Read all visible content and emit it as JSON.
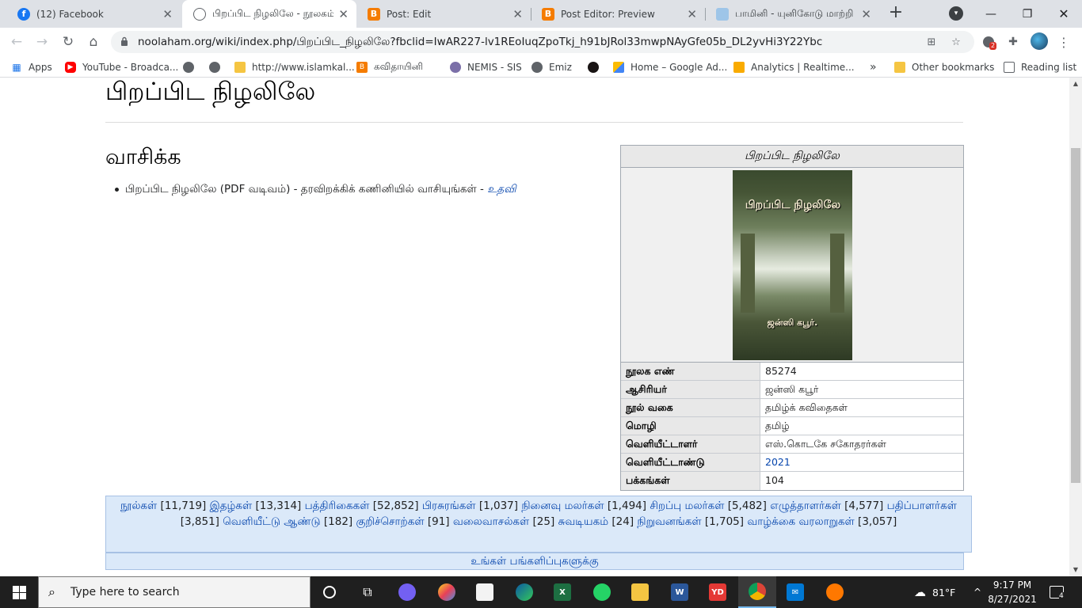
{
  "tabs": [
    {
      "title": "(12) Facebook",
      "close": "✕"
    },
    {
      "title": "பிறப்பிட நிழலிலே - நூலகம்",
      "close": "✕"
    },
    {
      "title": "Post: Edit",
      "close": "✕"
    },
    {
      "title": "Post Editor: Preview",
      "close": "✕"
    },
    {
      "title": "பாமினி - யுனிகோடு மாற்றி",
      "close": "✕"
    }
  ],
  "browser": {
    "url": "noolaham.org/wiki/index.php/பிறப்பிட_நிழலிலே?fbclid=IwAR227-lv1REoIuqZpoTkj_h91bJRol33mwpNAyGfe05b_DL2yvHi3Y22Ybc",
    "extension_badge": "2"
  },
  "bookmarks": [
    {
      "label": "Apps"
    },
    {
      "label": "YouTube - Broadca..."
    },
    {
      "label": "http://www.islamkal..."
    },
    {
      "label": "கவிதாயினி"
    },
    {
      "label": "NEMIS - SIS"
    },
    {
      "label": "Emiz"
    },
    {
      "label": "Home – Google Ad..."
    },
    {
      "label": "Analytics | Realtime..."
    },
    {
      "label": "»"
    },
    {
      "label": "Other bookmarks"
    },
    {
      "label": "Reading list"
    }
  ],
  "page": {
    "title": "பிறப்பிட நிழலிலே",
    "section_heading": "வாசிக்க",
    "read_item": "பிறப்பிட நிழலிலே (PDF வடிவம்) - தரவிறக்கிக் கணினியில் வாசியுங்கள் -",
    "help_link": "உதவி"
  },
  "infobox": {
    "title": "பிறப்பிட நிழலிலே",
    "cover_title": "பிறப்பிட நிழலிலே",
    "cover_author": "ஜன்ஸி கபூர்.",
    "rows": [
      {
        "key": "நூலக எண்",
        "value": "85274"
      },
      {
        "key": "ஆசிரியர்",
        "value": "ஜன்ஸி கபூர்"
      },
      {
        "key": "நூல் வகை",
        "value": "தமிழ்க் கவிதைகள்"
      },
      {
        "key": "மொழி",
        "value": "தமிழ்"
      },
      {
        "key": "வெளியீட்டாளர்",
        "value": "எஸ்.கொடகே சகோதரர்கள்"
      },
      {
        "key": "வெளியீட்டாண்டு",
        "value": "2021"
      },
      {
        "key": "பக்கங்கள்",
        "value": "104"
      }
    ]
  },
  "categories": [
    {
      "label": "நூல்கள்",
      "count": "[11,719]"
    },
    {
      "label": "இதழ்கள்",
      "count": "[13,314]"
    },
    {
      "label": "பத்திரிகைகள்",
      "count": "[52,852]"
    },
    {
      "label": "பிரசுரங்கள்",
      "count": "[1,037]"
    },
    {
      "label": "நினைவு மலர்கள்",
      "count": "[1,494]"
    },
    {
      "label": "சிறப்பு மலர்கள்",
      "count": "[5,482]"
    },
    {
      "label": "எழுத்தாளர்கள்",
      "count": "[4,577]"
    },
    {
      "label": "பதிப்பாளர்கள்",
      "count": "[3,851]"
    },
    {
      "label": "வெளியீட்டு ஆண்டு",
      "count": "[182]"
    },
    {
      "label": "குறிச்சொற்கள்",
      "count": "[91]"
    },
    {
      "label": "வலைவாசல்கள்",
      "count": "[25]"
    },
    {
      "label": "சுவடியகம்",
      "count": "[24]"
    },
    {
      "label": "நிறுவனங்கள்",
      "count": "[1,705]"
    },
    {
      "label": "வாழ்க்கை வரலாறுகள்",
      "count": "[3,057]"
    }
  ],
  "share_link": "உங்கள் பங்களிப்புகளுக்கு",
  "taskbar": {
    "search_placeholder": "Type here to search",
    "temperature": "81°F",
    "time": "9:17 PM",
    "date": "8/27/2021",
    "notifications": "4"
  },
  "colors": {
    "link": "#0645ad",
    "catbox_bg": "#dbe9f9",
    "tab_strip": "#dee1e6"
  }
}
